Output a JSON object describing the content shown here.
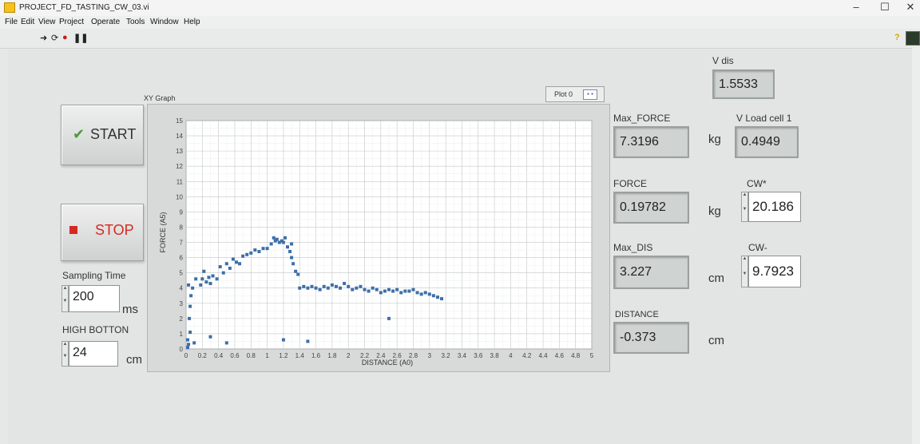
{
  "window": {
    "title": "PROJECT_FD_TASTING_CW_03.vi",
    "controls": [
      "–",
      "☐",
      "✕"
    ]
  },
  "menu": [
    "File",
    "Edit",
    "View",
    "Project",
    "Operate",
    "Tools",
    "Window",
    "Help"
  ],
  "toolbar": {
    "run_icon": "run-arrow-icon",
    "run_cont_icon": "run-continuously-icon",
    "abort_icon": "abort-icon",
    "pause_icon": "pause-icon",
    "help_icon": "help-icon"
  },
  "buttons": {
    "start": "START",
    "stop": "STOP"
  },
  "sampling": {
    "label": "Sampling Time",
    "value": "200",
    "unit": "ms"
  },
  "high_bottom": {
    "label": "HIGH BOTTON",
    "value": "24",
    "unit": "cm"
  },
  "graph": {
    "label": "XY Graph",
    "legend": "Plot 0"
  },
  "readouts": {
    "v_dis": {
      "label": "V dis",
      "value": "1.5533"
    },
    "max_force": {
      "label": "Max_FORCE",
      "value": "7.3196",
      "unit": "kg"
    },
    "v_load": {
      "label": "V Load cell 1",
      "value": "0.4949"
    },
    "force": {
      "label": "FORCE",
      "value": "0.19782",
      "unit": "kg"
    },
    "cw_plus": {
      "label": "CW*",
      "value": "20.186"
    },
    "max_dis": {
      "label": "Max_DIS",
      "value": "3.227",
      "unit": "cm"
    },
    "cw_minus": {
      "label": "CW-",
      "value": "9.7923"
    },
    "distance": {
      "label": "DISTANCE",
      "value": "-0.373",
      "unit": "cm"
    }
  },
  "colors": {
    "point": "#3d6fa8",
    "grid": "#c3c7c7",
    "plot_bg": "#ffffff"
  },
  "chart_data": {
    "type": "scatter",
    "xlabel": "DISTANCE (A0)",
    "ylabel": "FORCE (A5)",
    "xlim": [
      0,
      5
    ],
    "ylim": [
      0,
      15
    ],
    "xticks": [
      "0",
      "0.2",
      "0.4",
      "0.6",
      "0.8",
      "1",
      "1.2",
      "1.4",
      "1.6",
      "1.8",
      "2",
      "2.2",
      "2.4",
      "2.6",
      "2.8",
      "3",
      "3.2",
      "3.4",
      "3.6",
      "3.8",
      "4",
      "4.2",
      "4.4",
      "4.6",
      "4.8",
      "5"
    ],
    "yticks": [
      "0",
      "1",
      "2",
      "3",
      "4",
      "5",
      "6",
      "7",
      "8",
      "9",
      "10",
      "11",
      "12",
      "13",
      "14",
      "15"
    ],
    "grid": true,
    "points": [
      [
        0.02,
        0.1
      ],
      [
        0.03,
        0.3
      ],
      [
        0.02,
        0.6
      ],
      [
        0.05,
        1.1
      ],
      [
        0.04,
        2.0
      ],
      [
        0.05,
        2.8
      ],
      [
        0.06,
        3.5
      ],
      [
        0.03,
        4.2
      ],
      [
        0.08,
        4.0
      ],
      [
        0.12,
        4.6
      ],
      [
        0.1,
        0.4
      ],
      [
        0.18,
        4.2
      ],
      [
        0.2,
        4.6
      ],
      [
        0.22,
        5.1
      ],
      [
        0.25,
        4.4
      ],
      [
        0.28,
        4.7
      ],
      [
        0.3,
        4.3
      ],
      [
        0.33,
        4.8
      ],
      [
        0.38,
        4.6
      ],
      [
        0.42,
        5.4
      ],
      [
        0.46,
        5.0
      ],
      [
        0.5,
        5.6
      ],
      [
        0.54,
        5.3
      ],
      [
        0.58,
        5.9
      ],
      [
        0.62,
        5.7
      ],
      [
        0.66,
        5.6
      ],
      [
        0.7,
        6.1
      ],
      [
        0.75,
        6.2
      ],
      [
        0.8,
        6.3
      ],
      [
        0.85,
        6.5
      ],
      [
        0.9,
        6.4
      ],
      [
        0.95,
        6.6
      ],
      [
        1.0,
        6.6
      ],
      [
        1.05,
        6.9
      ],
      [
        1.08,
        7.3
      ],
      [
        1.12,
        7.2
      ],
      [
        1.15,
        7.0
      ],
      [
        1.18,
        7.1
      ],
      [
        1.22,
        7.3
      ],
      [
        1.25,
        6.7
      ],
      [
        1.28,
        6.4
      ],
      [
        1.3,
        6.0
      ],
      [
        1.32,
        5.6
      ],
      [
        1.35,
        5.1
      ],
      [
        1.38,
        4.9
      ],
      [
        1.4,
        4.0
      ],
      [
        1.3,
        6.9
      ],
      [
        1.2,
        7.0
      ],
      [
        1.1,
        7.1
      ],
      [
        0.5,
        0.4
      ],
      [
        1.45,
        4.1
      ],
      [
        1.5,
        4.0
      ],
      [
        1.55,
        4.1
      ],
      [
        1.6,
        4.0
      ],
      [
        1.65,
        3.9
      ],
      [
        1.7,
        4.1
      ],
      [
        1.75,
        4.0
      ],
      [
        1.8,
        4.2
      ],
      [
        1.85,
        4.1
      ],
      [
        1.9,
        4.0
      ],
      [
        1.95,
        4.3
      ],
      [
        2.0,
        4.1
      ],
      [
        2.05,
        3.9
      ],
      [
        2.1,
        4.0
      ],
      [
        2.15,
        4.1
      ],
      [
        2.2,
        3.9
      ],
      [
        2.25,
        3.8
      ],
      [
        2.3,
        4.0
      ],
      [
        2.35,
        3.9
      ],
      [
        2.4,
        3.7
      ],
      [
        2.45,
        3.8
      ],
      [
        2.5,
        3.9
      ],
      [
        2.55,
        3.8
      ],
      [
        2.6,
        3.9
      ],
      [
        2.65,
        3.7
      ],
      [
        2.7,
        3.8
      ],
      [
        2.75,
        3.8
      ],
      [
        2.8,
        3.9
      ],
      [
        2.85,
        3.7
      ],
      [
        2.9,
        3.6
      ],
      [
        2.95,
        3.7
      ],
      [
        3.0,
        3.6
      ],
      [
        3.05,
        3.5
      ],
      [
        3.1,
        3.4
      ],
      [
        3.15,
        3.3
      ],
      [
        2.5,
        2.0
      ],
      [
        1.2,
        0.6
      ],
      [
        1.5,
        0.5
      ],
      [
        0.3,
        0.8
      ]
    ]
  }
}
